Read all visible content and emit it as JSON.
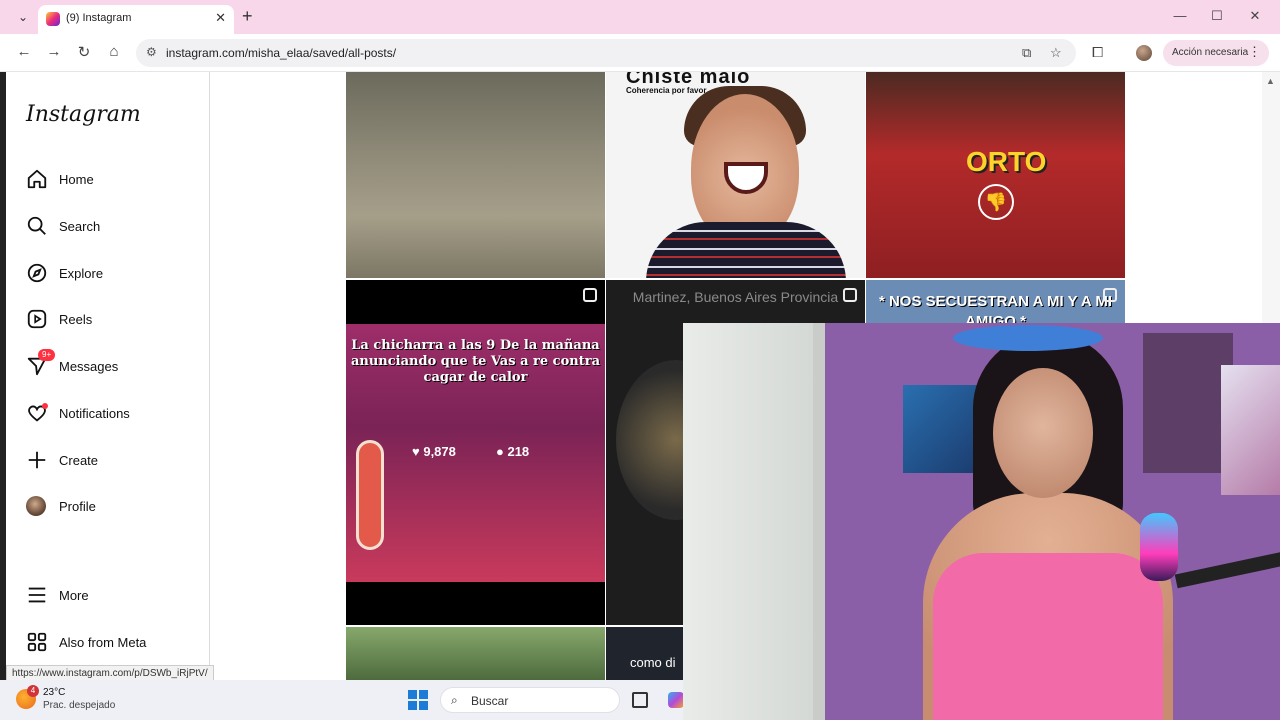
{
  "browser": {
    "tab_title": "(9) Instagram",
    "tab_close": "✕",
    "new_tab": "+",
    "url": "instagram.com/misha_elaa/saved/all-posts/",
    "action_button": "Acción necesaria"
  },
  "instagram": {
    "logo": "Instagram",
    "nav": [
      {
        "label": "Home",
        "icon": "home-icon"
      },
      {
        "label": "Search",
        "icon": "search-icon"
      },
      {
        "label": "Explore",
        "icon": "compass-icon"
      },
      {
        "label": "Reels",
        "icon": "reels-icon"
      },
      {
        "label": "Messages",
        "icon": "messenger-icon",
        "badge": "9+"
      },
      {
        "label": "Notifications",
        "icon": "heart-icon"
      },
      {
        "label": "Create",
        "icon": "plus-icon"
      },
      {
        "label": "Profile",
        "icon": "avatar"
      },
      {
        "label": "More",
        "icon": "menu-icon"
      },
      {
        "label": "Also from Meta",
        "icon": "meta-icon"
      }
    ]
  },
  "posts": {
    "p2_title": "Chiste malo",
    "p2_subtitle": "Coherencia por favor",
    "p3_text": "ORTO",
    "p4_text": "La chicharra a las 9 De la mañana anunciando que te Vas a re contra cagar de calor",
    "p4_likes": "9,878",
    "p4_comments": "218",
    "p5_text": "Martinez, Buenos Aires Provincia",
    "p6_text": "* NOS SECUESTRAN A MI Y A MI AMIGO *",
    "p8_text": "como di"
  },
  "status_url": "https://www.instagram.com/p/DSWb_iRjPtV/",
  "taskbar": {
    "weather_badge": "4",
    "weather_temp": "23°C",
    "weather_desc": "Prac. despejado",
    "search_placeholder": "Buscar"
  },
  "colors": {
    "tabbar_bg": "#f8d7ea",
    "notification_red": "#ff3040",
    "taskbar_bg": "#eef0f6"
  }
}
